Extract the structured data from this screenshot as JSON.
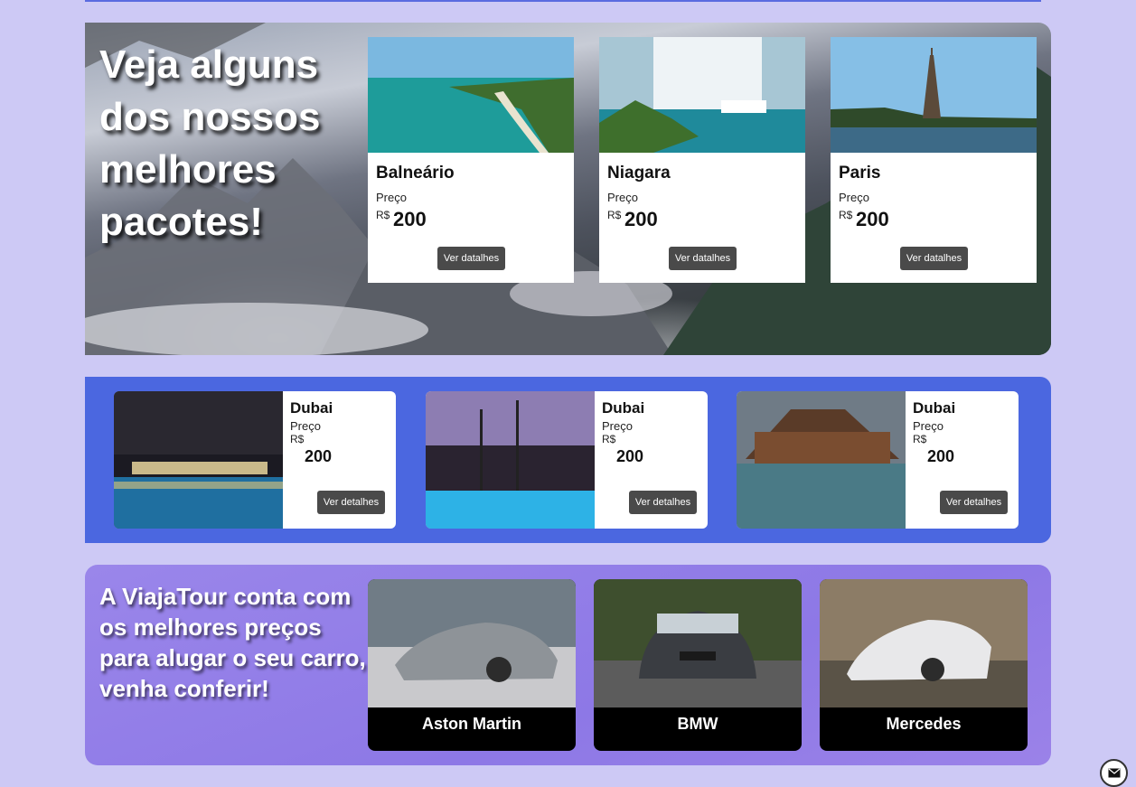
{
  "hero": {
    "title": "Veja alguns dos nossos melhores pacotes!",
    "packages": [
      {
        "name": "Balneário",
        "price_label": "Preço",
        "currency": "R$",
        "amount": "200",
        "button": "Ver datalhes"
      },
      {
        "name": "Niagara",
        "price_label": "Preço",
        "currency": "R$",
        "amount": "200",
        "button": "Ver datalhes"
      },
      {
        "name": "Paris",
        "price_label": "Preço",
        "currency": "R$",
        "amount": "200",
        "button": "Ver datalhes"
      }
    ]
  },
  "hotels": [
    {
      "name": "Dubai",
      "price_label": "Preço",
      "currency": "R$",
      "amount": "200",
      "button": "Ver detalhes"
    },
    {
      "name": "Dubai",
      "price_label": "Preço",
      "currency": "R$",
      "amount": "200",
      "button": "Ver detalhes"
    },
    {
      "name": "Dubai",
      "price_label": "Preço",
      "currency": "R$",
      "amount": "200",
      "button": "Ver detalhes"
    }
  ],
  "cars": {
    "title": "A ViajaTour conta com os melhores preços para alugar o seu carro, venha conferir!",
    "items": [
      {
        "name": "Aston Martin"
      },
      {
        "name": "BMW"
      },
      {
        "name": "Mercedes"
      }
    ]
  },
  "icons": {
    "contact": "mail-icon"
  },
  "colors": {
    "page_bg": "#cdc9f5",
    "strip_bg": "#4b67e0",
    "cars_bg": "#9a86ea",
    "button_bg": "#4a4a4a"
  }
}
